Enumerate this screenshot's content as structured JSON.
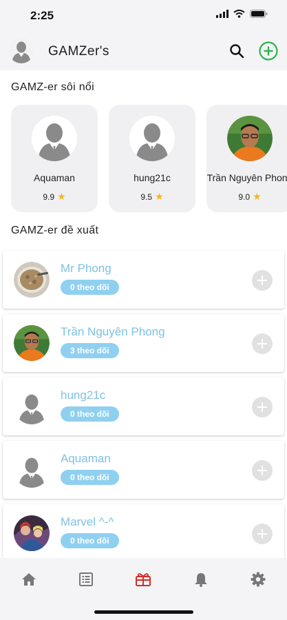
{
  "status_bar": {
    "time": "2:25"
  },
  "header": {
    "title": "GAMZer's"
  },
  "hot_section": {
    "title": "GAMZ-er sôi nổi",
    "cards": [
      {
        "name": "Aquaman",
        "rating": "9.9",
        "avatar": "person-placeholder"
      },
      {
        "name": "hung21c",
        "rating": "9.5",
        "avatar": "person-placeholder"
      },
      {
        "name": "Trần Nguyên Phong",
        "rating": "9.0",
        "avatar": "photo-man-orange-shirt"
      }
    ]
  },
  "suggest_section": {
    "title": "GAMZ-er đề xuất",
    "users": [
      {
        "name": "Mr Phong",
        "followers": "0 theo dõi",
        "avatar": "photo-food-dish"
      },
      {
        "name": "Trần Nguyên Phong",
        "followers": "3 theo dõi",
        "avatar": "photo-man-orange-shirt"
      },
      {
        "name": "hung21c",
        "followers": "0 theo dõi",
        "avatar": "person-placeholder"
      },
      {
        "name": "Aquaman",
        "followers": "0 theo dõi",
        "avatar": "person-placeholder"
      },
      {
        "name": "Marvel ^-^",
        "followers": "0 theo dõi",
        "avatar": "photo-anime-characters"
      }
    ]
  },
  "tabbar": {
    "tabs": [
      {
        "icon": "home-icon",
        "active": false
      },
      {
        "icon": "list-icon",
        "active": false
      },
      {
        "icon": "gift-icon",
        "active": true
      },
      {
        "icon": "bell-icon",
        "active": false
      },
      {
        "icon": "gear-icon",
        "active": false
      }
    ]
  },
  "colors": {
    "accent_green": "#2bb24c",
    "name_blue": "#7dc1e3",
    "badge_blue": "#8fd0f0",
    "active_tab": "#d42c2c",
    "star": "#f2b61f"
  }
}
